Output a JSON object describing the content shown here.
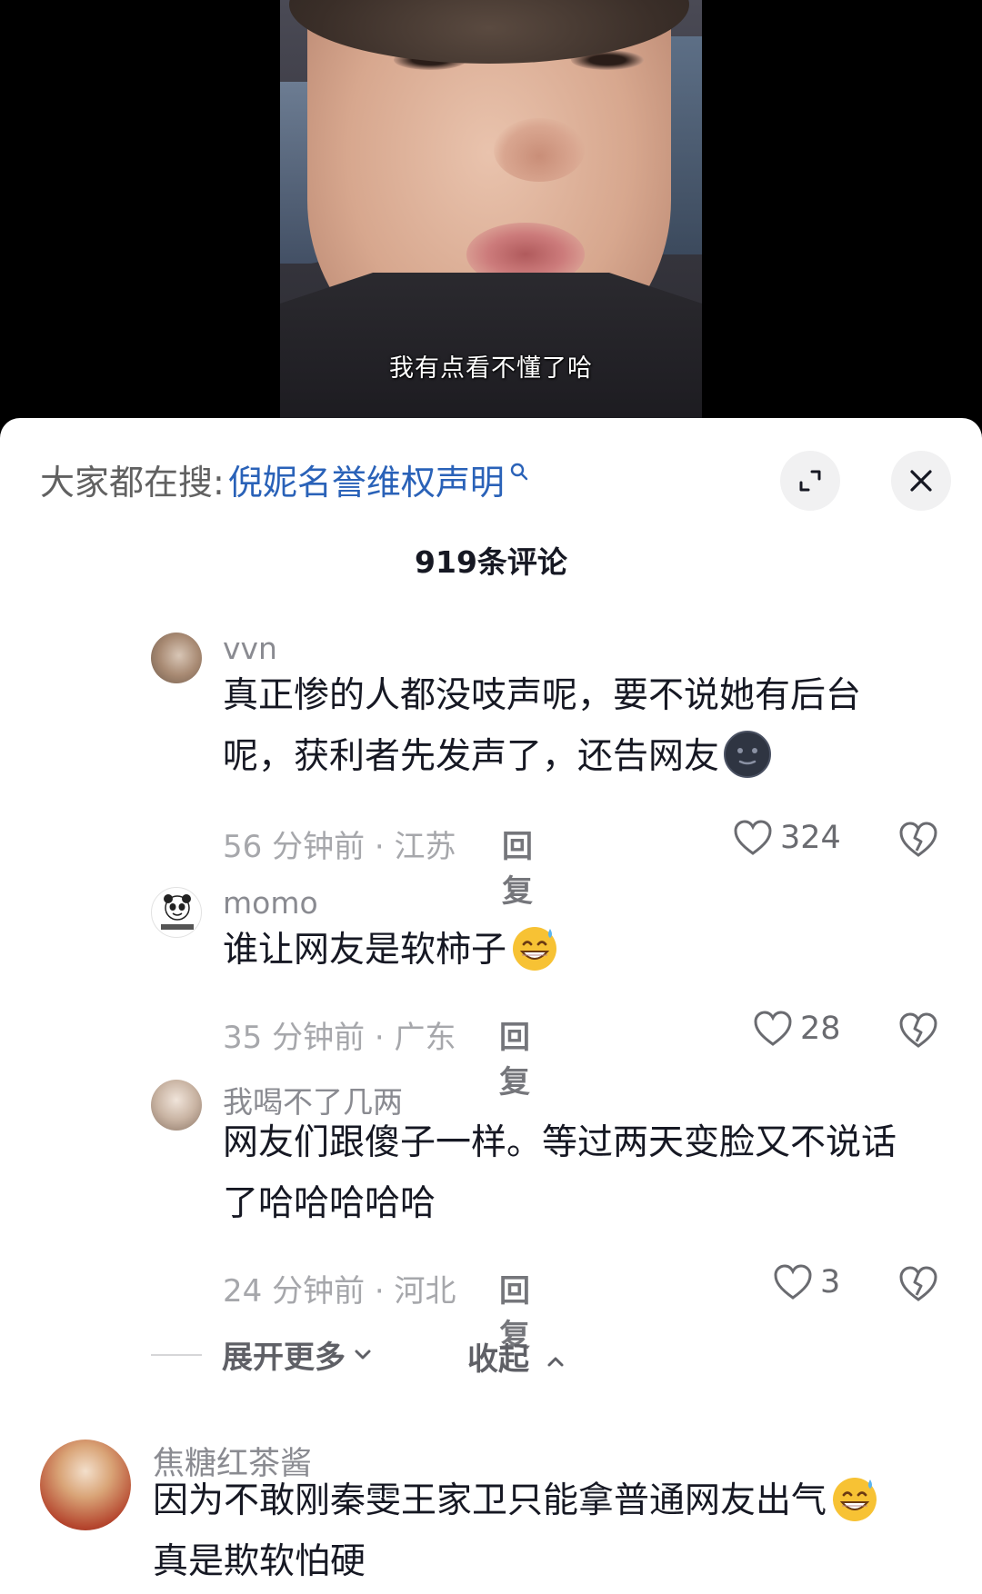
{
  "video": {
    "subtitle": "我有点看不懂了哈"
  },
  "sheet": {
    "search_prefix": "大家都在搜:",
    "search_term": "倪妮名誉维权声明",
    "comment_count": "919条评论",
    "expand_icon": "expand-icon",
    "close_icon": "close-icon"
  },
  "comments": [
    {
      "username": "vvn",
      "text": "真正惨的人都没吱声呢，要不说她有后台呢，获利者先发声了，还告网友",
      "emoji": "new-moon-face-emoji",
      "meta": "56 分钟前 · 江苏",
      "reply": "回复",
      "likes": "324"
    },
    {
      "username": "momo",
      "text": "谁让网友是软柿子",
      "emoji": "grinning-sweat-emoji",
      "meta": "35 分钟前 · 广东",
      "reply": "回复",
      "likes": "28"
    },
    {
      "username": "我喝不了几两",
      "text": "网友们跟傻子一样。等过两天变脸又不说话了哈哈哈哈哈",
      "meta": "24 分钟前 · 河北",
      "reply": "回复",
      "likes": "3"
    }
  ],
  "thread_controls": {
    "expand_more": "展开更多",
    "collapse": "收起"
  },
  "top_comment": {
    "username": "焦糖红茶酱",
    "text_line1": "因为不敢刚秦雯王家卫只能拿普通网友出气",
    "emoji": "grinning-sweat-emoji",
    "text_line2": "真是欺软怕硬"
  },
  "colors": {
    "link_blue": "#2a62b8",
    "text_primary": "#161823",
    "text_secondary": "#8a8b91"
  }
}
